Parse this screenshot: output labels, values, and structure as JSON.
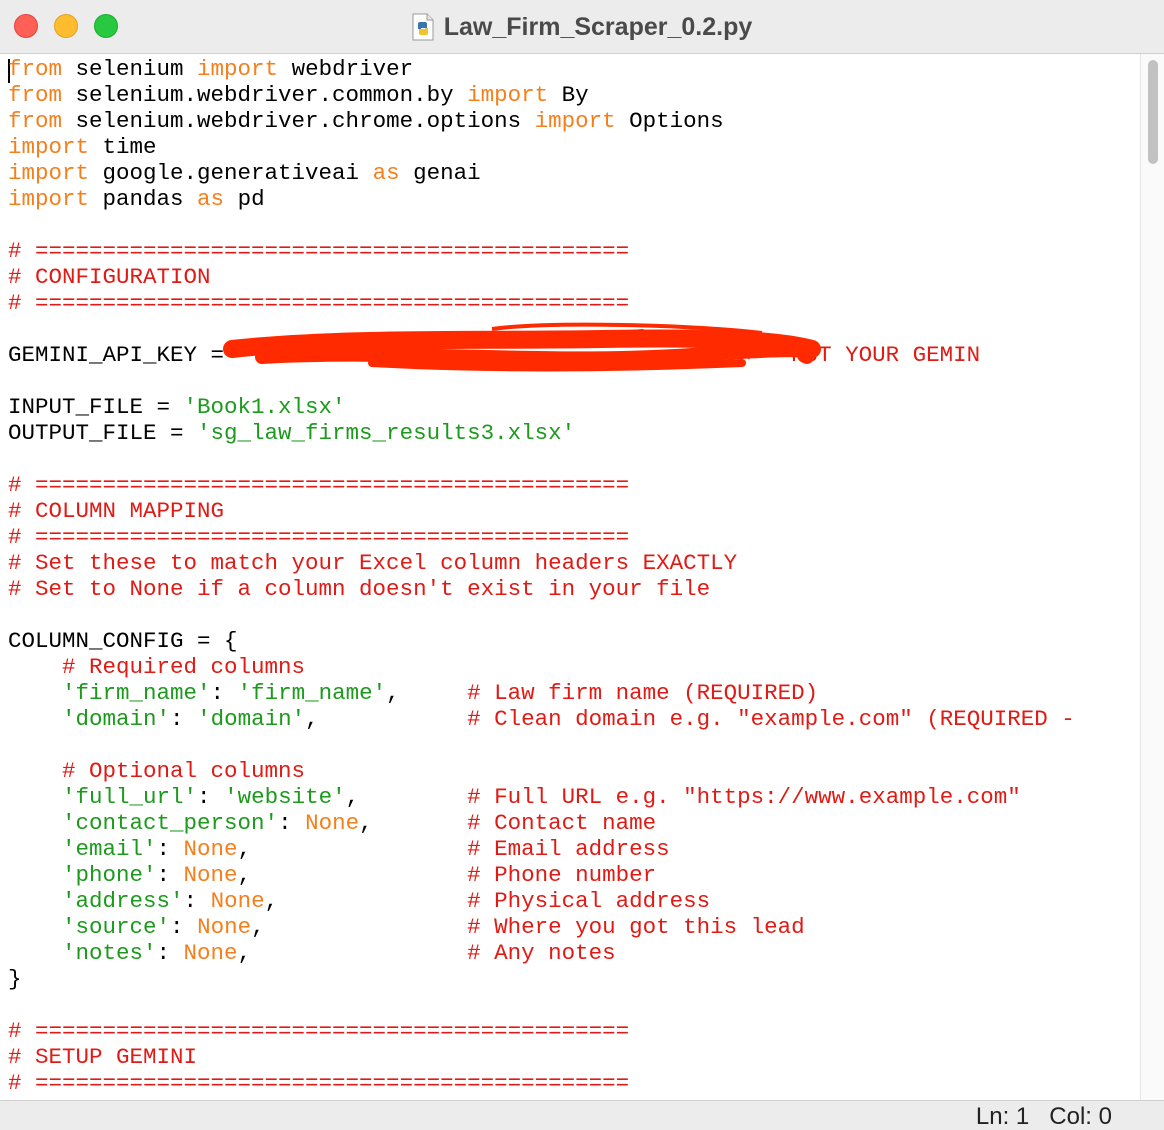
{
  "window": {
    "title": "Law_Firm_Scraper_0.2.py",
    "icon": "python-file-icon"
  },
  "colors": {
    "keyword": "#f57f1c",
    "string": "#1c9a1c",
    "comment": "#e01a14",
    "text": "#000000",
    "redaction": "#ff2a00"
  },
  "code": {
    "lines": [
      [
        [
          "kw",
          "from"
        ],
        [
          "plain",
          " selenium "
        ],
        [
          "kw",
          "import"
        ],
        [
          "plain",
          " webdriver"
        ]
      ],
      [
        [
          "kw",
          "from"
        ],
        [
          "plain",
          " selenium.webdriver.common.by "
        ],
        [
          "kw",
          "import"
        ],
        [
          "plain",
          " By"
        ]
      ],
      [
        [
          "kw",
          "from"
        ],
        [
          "plain",
          " selenium.webdriver.chrome.options "
        ],
        [
          "kw",
          "import"
        ],
        [
          "plain",
          " Options"
        ]
      ],
      [
        [
          "kw",
          "import"
        ],
        [
          "plain",
          " time"
        ]
      ],
      [
        [
          "kw",
          "import"
        ],
        [
          "plain",
          " google.generativeai "
        ],
        [
          "kw",
          "as"
        ],
        [
          "plain",
          " genai"
        ]
      ],
      [
        [
          "kw",
          "import"
        ],
        [
          "plain",
          " pandas "
        ],
        [
          "kw",
          "as"
        ],
        [
          "plain",
          " pd"
        ]
      ],
      [],
      [
        [
          "cm",
          "# ============================================"
        ]
      ],
      [
        [
          "cm",
          "# CONFIGURATION"
        ]
      ],
      [
        [
          "cm",
          "# ============================================"
        ]
      ],
      [],
      [
        [
          "plain",
          "GEMINI_API_KEY = "
        ],
        [
          "plain",
          "                                  "
        ],
        [
          "cm",
          " # <-- PUT YOUR GEMIN"
        ]
      ],
      [],
      [
        [
          "plain",
          "INPUT_FILE = "
        ],
        [
          "str",
          "'Book1.xlsx'"
        ]
      ],
      [
        [
          "plain",
          "OUTPUT_FILE = "
        ],
        [
          "str",
          "'sg_law_firms_results3.xlsx'"
        ]
      ],
      [],
      [
        [
          "cm",
          "# ============================================"
        ]
      ],
      [
        [
          "cm",
          "# COLUMN MAPPING"
        ]
      ],
      [
        [
          "cm",
          "# ============================================"
        ]
      ],
      [
        [
          "cm",
          "# Set these to match your Excel column headers EXACTLY"
        ]
      ],
      [
        [
          "cm",
          "# Set to None if a column doesn't exist in your file"
        ]
      ],
      [],
      [
        [
          "plain",
          "COLUMN_CONFIG = {"
        ]
      ],
      [
        [
          "plain",
          "    "
        ],
        [
          "cm",
          "# Required columns"
        ]
      ],
      [
        [
          "plain",
          "    "
        ],
        [
          "str",
          "'firm_name'"
        ],
        [
          "plain",
          ": "
        ],
        [
          "str",
          "'firm_name'"
        ],
        [
          "plain",
          ",     "
        ],
        [
          "cm",
          "# Law firm name (REQUIRED)"
        ]
      ],
      [
        [
          "plain",
          "    "
        ],
        [
          "str",
          "'domain'"
        ],
        [
          "plain",
          ": "
        ],
        [
          "str",
          "'domain'"
        ],
        [
          "plain",
          ",           "
        ],
        [
          "cm",
          "# Clean domain e.g. \"example.com\" (REQUIRED -"
        ]
      ],
      [],
      [
        [
          "plain",
          "    "
        ],
        [
          "cm",
          "# Optional columns"
        ]
      ],
      [
        [
          "plain",
          "    "
        ],
        [
          "str",
          "'full_url'"
        ],
        [
          "plain",
          ": "
        ],
        [
          "str",
          "'website'"
        ],
        [
          "plain",
          ",        "
        ],
        [
          "cm",
          "# Full URL e.g. \"https://www.example.com\""
        ]
      ],
      [
        [
          "plain",
          "    "
        ],
        [
          "str",
          "'contact_person'"
        ],
        [
          "plain",
          ": "
        ],
        [
          "kw",
          "None"
        ],
        [
          "plain",
          ",       "
        ],
        [
          "cm",
          "# Contact name"
        ]
      ],
      [
        [
          "plain",
          "    "
        ],
        [
          "str",
          "'email'"
        ],
        [
          "plain",
          ": "
        ],
        [
          "kw",
          "None"
        ],
        [
          "plain",
          ",                "
        ],
        [
          "cm",
          "# Email address"
        ]
      ],
      [
        [
          "plain",
          "    "
        ],
        [
          "str",
          "'phone'"
        ],
        [
          "plain",
          ": "
        ],
        [
          "kw",
          "None"
        ],
        [
          "plain",
          ",                "
        ],
        [
          "cm",
          "# Phone number"
        ]
      ],
      [
        [
          "plain",
          "    "
        ],
        [
          "str",
          "'address'"
        ],
        [
          "plain",
          ": "
        ],
        [
          "kw",
          "None"
        ],
        [
          "plain",
          ",              "
        ],
        [
          "cm",
          "# Physical address"
        ]
      ],
      [
        [
          "plain",
          "    "
        ],
        [
          "str",
          "'source'"
        ],
        [
          "plain",
          ": "
        ],
        [
          "kw",
          "None"
        ],
        [
          "plain",
          ",               "
        ],
        [
          "cm",
          "# Where you got this lead"
        ]
      ],
      [
        [
          "plain",
          "    "
        ],
        [
          "str",
          "'notes'"
        ],
        [
          "plain",
          ": "
        ],
        [
          "kw",
          "None"
        ],
        [
          "plain",
          ",                "
        ],
        [
          "cm",
          "# Any notes"
        ]
      ],
      [
        [
          "plain",
          "}"
        ]
      ],
      [],
      [
        [
          "cm",
          "# ============================================"
        ]
      ],
      [
        [
          "cm",
          "# SETUP GEMINI"
        ]
      ],
      [
        [
          "cm",
          "# ============================================"
        ]
      ]
    ]
  },
  "status": {
    "line_label": "Ln: 1",
    "col_label": "Col: 0"
  }
}
